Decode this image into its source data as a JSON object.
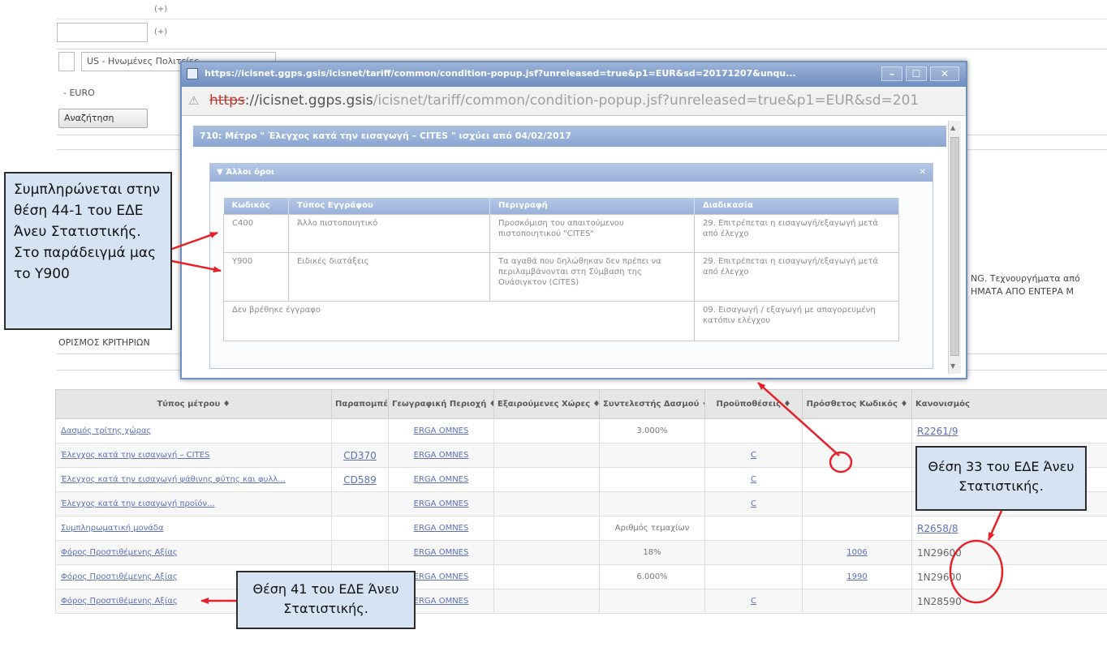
{
  "background": {
    "top_mini": "(+)",
    "field_country": "US - Ηνωμένες Πολιτείες",
    "field_currency": "- EURO",
    "search_button": "Αναζήτηση",
    "criteria_label": "ΟΡΙΣΜΟΣ ΚΡΙΤΗΡΙΩΝ",
    "right_text_1": "ΝG. Τεχνουργήματα από",
    "right_text_2": "ΗΜΑΤΑ ΑΠΟ ΕΝΤΕΡΑ Μ"
  },
  "popup": {
    "window_title": "https://icisnet.ggps.gsis/icisnet/tariff/common/condition-popup.jsf?unreleased=true&p1=EUR&sd=20171207&unqu...",
    "url_https": "https",
    "url_host": "://icisnet.ggps.gsis",
    "url_path": "/icisnet/tariff/common/condition-popup.jsf?unreleased=true&p1=EUR&sd=201",
    "header": "710: Μέτρο \" Έλεγχος κατά την εισαγωγή – CITES \" ισχύει από 04/02/2017",
    "panel_title": "Άλλοι όροι",
    "columns": [
      "Κωδικός",
      "Τύπος Εγγράφου",
      "Περιγραφή",
      "Διαδικασία"
    ],
    "rows": [
      {
        "code": "C400",
        "type": "Άλλο πιστοποιητικό",
        "description": "Προσκόμιση του απαιτούμενου πιστοποιητικού \"CITES\"",
        "procedure": "29. Επιτρέπεται η εισαγωγή/εξαγωγή μετά από έλεγχο"
      },
      {
        "code": "Y900",
        "type": "Ειδικές διατάξεις",
        "description": "Τα αγαθά που δηλώθηκαν δεν πρέπει να περιλαμβάνονται στη Σύμβαση της Ουάσιγκτον (CITES)",
        "procedure": "29. Επιτρέπεται η εισαγωγή/εξαγωγή μετά από έλεγχο"
      },
      {
        "code": "",
        "type": "Δεν βρέθηκε έγγραφο",
        "description": "",
        "procedure": "09. Εισαγωγή / εξαγωγή με απαγορευμένη κατόπιν ελέγχου"
      }
    ]
  },
  "main_table": {
    "columns": [
      "Τύπος μέτρου",
      "Παραπομπές",
      "Γεωγραφική Περιοχή",
      "Εξαιρούμενες Χώρες",
      "Συντελεστής Δασμού",
      "Προϋποθέσεις",
      "Πρόσθετος Κωδικός",
      "Κανονισμός"
    ],
    "rows": [
      {
        "type": "Δασμός τρίτης χώρας",
        "ref": "",
        "geo": "ERGA OMNES",
        "excl": "",
        "duty": "3.000%",
        "cond": "",
        "addcode": "",
        "reg": "R2261/9"
      },
      {
        "type": "Έλεγχος κατά την εισαγωγή – CITES",
        "ref": "CD370",
        "geo": "ERGA OMNES",
        "excl": "",
        "duty": "",
        "cond": "C",
        "addcode": "",
        "reg": ""
      },
      {
        "type": "Έλεγχος κατά την εισαγωγή ψάθινης φύτης και φυλλ...",
        "ref": "CD589",
        "geo": "ERGA OMNES",
        "excl": "",
        "duty": "",
        "cond": "C",
        "addcode": "",
        "reg": ""
      },
      {
        "type": "Έλεγχος κατά την εισαγωγή προϊόν...",
        "ref": "",
        "geo": "ERGA OMNES",
        "excl": "",
        "duty": "",
        "cond": "C",
        "addcode": "",
        "reg": ""
      },
      {
        "type": "Συμπληρωματική μονάδα",
        "ref": "",
        "geo": "ERGA OMNES",
        "excl": "",
        "duty": "Αριθμός τεμαχίων",
        "cond": "",
        "addcode": "",
        "reg": "R2658/8"
      },
      {
        "type": "Φόρος Προστιθέμενης Αξίας",
        "ref": "",
        "geo": "ERGA OMNES",
        "excl": "",
        "duty": "18%",
        "cond": "",
        "addcode": "1006",
        "reg": "1N29600"
      },
      {
        "type": "Φόρος Προστιθέμενης Αξίας",
        "ref": "",
        "geo": "ERGA OMNES",
        "excl": "",
        "duty": "6.000%",
        "cond": "",
        "addcode": "1990",
        "reg": "1N29600"
      },
      {
        "type": "Φόρος Προστιθέμενης Αξίας",
        "ref": "",
        "geo": "ERGA OMNES",
        "excl": "",
        "duty": "",
        "cond": "C",
        "addcode": "",
        "reg": "1N28590"
      }
    ]
  },
  "annotations": {
    "left": "Συμπληρώνεται στην θέση 44-1 του ΕΔΕ Άνευ Στατιστικής. Στο παράδειγμά μας το Y900",
    "middle": "Θέση 41 του ΕΔΕ Άνευ Στατιστικής.",
    "right": "Θέση 33 του ΕΔΕ Άνευ Στατιστικής.",
    "arrow_color": "#e8202a"
  }
}
